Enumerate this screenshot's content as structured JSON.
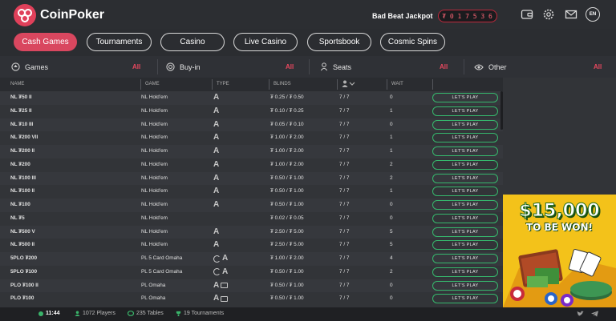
{
  "app": {
    "name": "CoinPoker",
    "language": "EN"
  },
  "colors": {
    "accent": "#d9475f",
    "play_border": "#36b86d",
    "banner_bg": "#f3c21a"
  },
  "jackpot": {
    "label": "Bad Beat Jackpot",
    "value": "₮ 0 1 7 5 3 6"
  },
  "header_icons": [
    "wallet-icon",
    "gear-icon",
    "mail-icon"
  ],
  "nav": {
    "tabs": [
      "Cash Games",
      "Tournaments",
      "Casino",
      "Live Casino",
      "Sportsbook",
      "Cosmic Spins"
    ],
    "active": "Cash Games"
  },
  "filters": [
    {
      "label": "Games",
      "value": "All",
      "icon": "spade-icon"
    },
    {
      "label": "Buy-in",
      "value": "All",
      "icon": "chip-icon"
    },
    {
      "label": "Seats",
      "value": "All",
      "icon": "person-icon"
    },
    {
      "label": "Other",
      "value": "All",
      "icon": "eye-icon"
    }
  ],
  "table": {
    "columns": [
      "NAME",
      "GAME",
      "TYPE",
      "BLINDS",
      "",
      "WAIT"
    ],
    "play_label": "LET'S PLAY",
    "rows": [
      {
        "name": "NL ₮50 II",
        "game": "NL  Hold'em",
        "type": "A",
        "blinds": "₮ 0.25 / ₮ 0.50",
        "seats": "7 / 7",
        "wait": "0"
      },
      {
        "name": "NL ₮25 II",
        "game": "NL  Hold'em",
        "type": "A",
        "blinds": "₮ 0.10 / ₮ 0.25",
        "seats": "7 / 7",
        "wait": "1"
      },
      {
        "name": "NL ₮10 III",
        "game": "NL  Hold'em",
        "type": "A",
        "blinds": "₮ 0.05 / ₮ 0.10",
        "seats": "7 / 7",
        "wait": "0"
      },
      {
        "name": "NL ₮200 VII",
        "game": "NL  Hold'em",
        "type": "A",
        "blinds": "₮ 1.00 / ₮ 2.00",
        "seats": "7 / 7",
        "wait": "1"
      },
      {
        "name": "NL ₮200 II",
        "game": "NL  Hold'em",
        "type": "A",
        "blinds": "₮ 1.00 / ₮ 2.00",
        "seats": "7 / 7",
        "wait": "1"
      },
      {
        "name": "NL ₮200",
        "game": "NL  Hold'em",
        "type": "A",
        "blinds": "₮ 1.00 / ₮ 2.00",
        "seats": "7 / 7",
        "wait": "2"
      },
      {
        "name": "NL ₮100 III",
        "game": "NL  Hold'em",
        "type": "A",
        "blinds": "₮ 0.50 / ₮ 1.00",
        "seats": "7 / 7",
        "wait": "2"
      },
      {
        "name": "NL ₮100 II",
        "game": "NL  Hold'em",
        "type": "A",
        "blinds": "₮ 0.50 / ₮ 1.00",
        "seats": "7 / 7",
        "wait": "1"
      },
      {
        "name": "NL ₮100",
        "game": "NL  Hold'em",
        "type": "A",
        "blinds": "₮ 0.50 / ₮ 1.00",
        "seats": "7 / 7",
        "wait": "0"
      },
      {
        "name": "NL ₮5",
        "game": "NL  Hold'em",
        "type": "",
        "blinds": "₮ 0.02 / ₮ 0.05",
        "seats": "7 / 7",
        "wait": "0"
      },
      {
        "name": "NL ₮500 V",
        "game": "NL  Hold'em",
        "type": "A",
        "blinds": "₮ 2.50 / ₮ 5.00",
        "seats": "7 / 7",
        "wait": "5"
      },
      {
        "name": "NL ₮500 II",
        "game": "NL  Hold'em",
        "type": "A",
        "blinds": "₮ 2.50 / ₮ 5.00",
        "seats": "7 / 7",
        "wait": "5"
      },
      {
        "name": "5PLO ₮200",
        "game": "PL  5 Card Omaha",
        "type": "spin-A",
        "blinds": "₮ 1.00 / ₮ 2.00",
        "seats": "7 / 7",
        "wait": "4"
      },
      {
        "name": "5PLO ₮100",
        "game": "PL  5 Card Omaha",
        "type": "spin-A",
        "blinds": "₮ 0.50 / ₮ 1.00",
        "seats": "7 / 7",
        "wait": "2"
      },
      {
        "name": "PLO ₮100 II",
        "game": "PL  Omaha",
        "type": "A-card",
        "blinds": "₮ 0.50 / ₮ 1.00",
        "seats": "7 / 7",
        "wait": "0"
      },
      {
        "name": "PLO ₮100",
        "game": "PL  Omaha",
        "type": "A-card",
        "blinds": "₮ 0.50 / ₮ 1.00",
        "seats": "7 / 7",
        "wait": "0"
      }
    ]
  },
  "banner": {
    "amount": "$15,000",
    "subtitle": "TO BE WON!"
  },
  "footer": {
    "time": "11:44",
    "players": "1072 Players",
    "tables": "235 Tables",
    "tournaments": "19 Tournaments",
    "social": [
      "twitter-icon",
      "telegram-icon"
    ]
  }
}
